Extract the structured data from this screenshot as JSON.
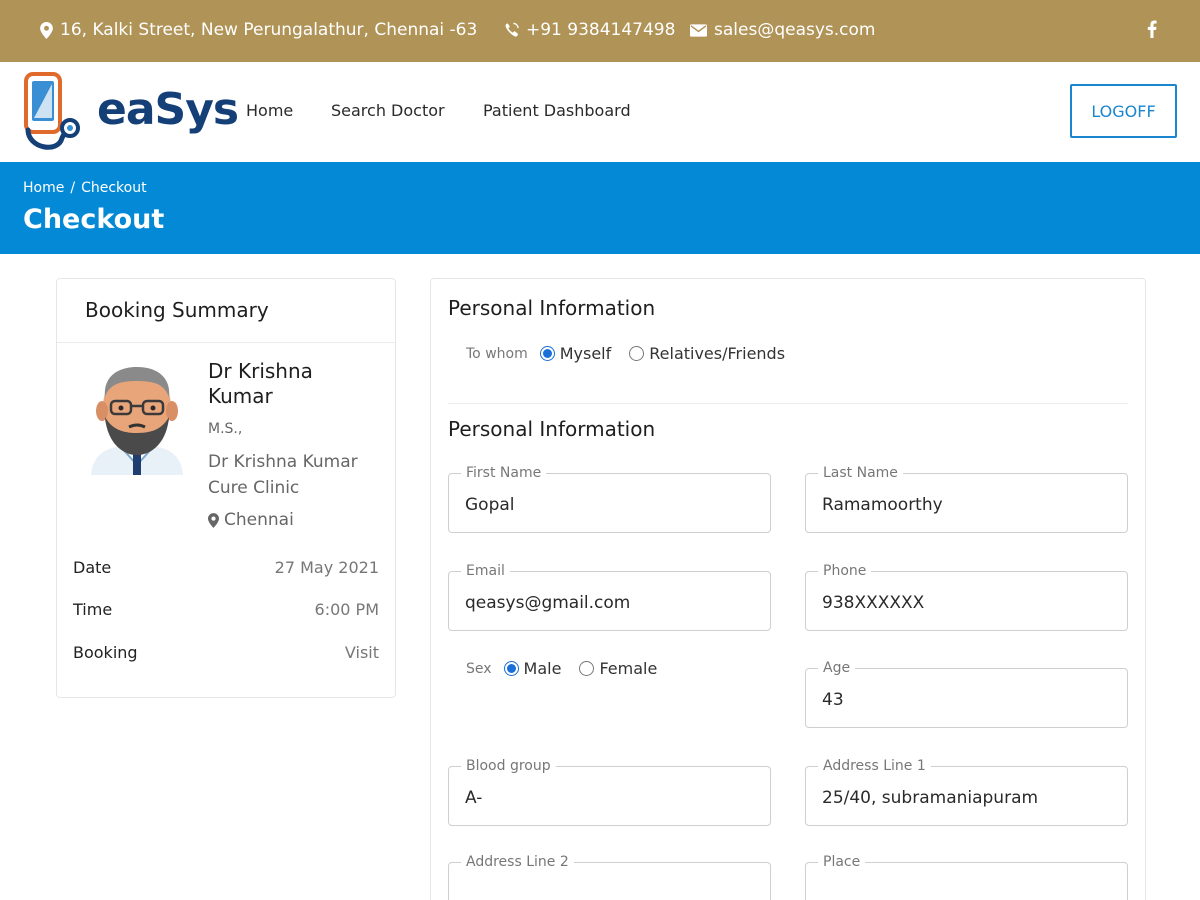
{
  "topbar": {
    "address": "16, Kalki Street, New Perungalathur, Chennai -63",
    "phone": "+91 9384147498",
    "email": "sales@qeasys.com",
    "icons": [
      "map-marker-icon",
      "phone-icon",
      "envelope-icon",
      "facebook-icon"
    ],
    "bg_color": "#b09357"
  },
  "header": {
    "logo_text": "eaSys",
    "nav": [
      "Home",
      "Search Doctor",
      "Patient Dashboard"
    ],
    "logoff_label": "LOGOFF",
    "accent_color": "#1a86d0"
  },
  "banner": {
    "breadcrumb": [
      "Home",
      "/",
      "Checkout"
    ],
    "title": "Checkout",
    "bg_color": "#0389d5"
  },
  "summary": {
    "title": "Booking Summary",
    "doctor_name": "Dr Krishna Kumar",
    "degree": "M.S.,",
    "clinic": "Dr Krishna Kumar Cure Clinic",
    "location": "Chennai",
    "rows": [
      {
        "key": "Date",
        "value": "27 May 2021"
      },
      {
        "key": "Time",
        "value": "6:00 PM"
      },
      {
        "key": "Booking",
        "value": "Visit"
      }
    ]
  },
  "form": {
    "section1_title": "Personal Information",
    "to_whom_label": "To whom",
    "to_whom_options": [
      "Myself",
      "Relatives/Friends"
    ],
    "to_whom_selected": "Myself",
    "section2_title": "Personal Information",
    "sex_label": "Sex",
    "sex_options": [
      "Male",
      "Female"
    ],
    "sex_selected": "Male",
    "fields": {
      "first_name": {
        "label": "First Name",
        "value": "Gopal"
      },
      "last_name": {
        "label": "Last Name",
        "value": "Ramamoorthy"
      },
      "email": {
        "label": "Email",
        "value": "qeasys@gmail.com"
      },
      "phone": {
        "label": "Phone",
        "value": "938XXXXXX"
      },
      "age": {
        "label": "Age",
        "value": "43"
      },
      "blood_group": {
        "label": "Blood group",
        "value": "A-"
      },
      "address1": {
        "label": "Address Line 1",
        "value": "25/40, subramaniapuram"
      },
      "address2": {
        "label": "Address Line 2",
        "value": ""
      },
      "place": {
        "label": "Place",
        "value": ""
      }
    }
  }
}
